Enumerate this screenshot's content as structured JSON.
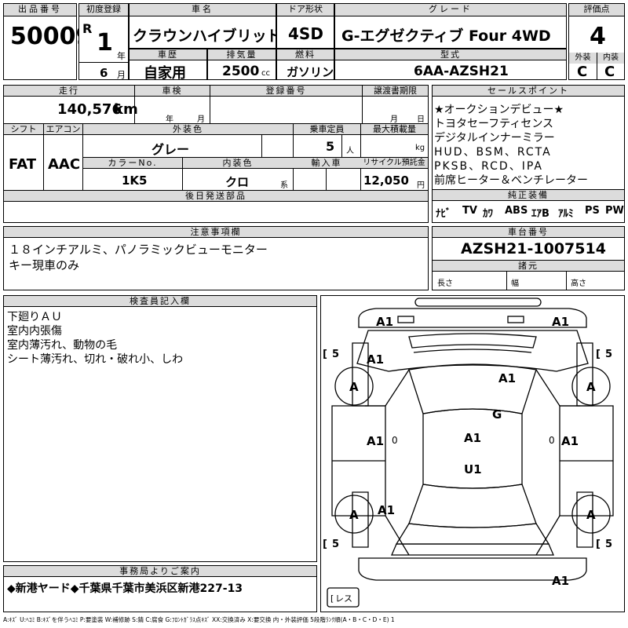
{
  "header": {
    "lot_label": "出品番号",
    "lot": "50009",
    "first_reg_label": "初度登録",
    "era": "R",
    "year": "1",
    "year_unit": "年",
    "month": "6",
    "month_unit": "月",
    "name_label": "車名",
    "name": "クラウンハイブリッド",
    "doors_label": "ドア形状",
    "doors": "4SD",
    "grade_label": "グレード",
    "grade": "G-エグゼクティブ Four 4WD",
    "score_label": "評価点",
    "score": "4",
    "ext_label": "外装",
    "ext": "C",
    "int_label": "内装",
    "int": "C",
    "history_label": "車歴",
    "history": "自家用",
    "disp_label": "排気量",
    "disp": "2500",
    "disp_unit": "cc",
    "fuel_label": "燃料",
    "fuel": "ガソリン",
    "model_label": "型式",
    "model": "6AA-AZSH21"
  },
  "specs": {
    "mileage_label": "走行",
    "mileage": "140,576",
    "mileage_unit": "km",
    "inspection_label": "車検",
    "insp_year": "年",
    "insp_month": "月",
    "reg_label": "登録番号",
    "transfer_label": "譲渡書期限",
    "transfer_month": "月",
    "transfer_day": "日",
    "shift_label": "シフト",
    "shift": "FAT",
    "ac_label": "エアコン",
    "ac": "AAC",
    "color_label": "外装色",
    "color": "グレー",
    "capacity_label": "乗車定員",
    "capacity": "5",
    "capacity_unit": "人",
    "load_label": "最大積載量",
    "load_unit": "kg",
    "colorno_label": "カラーNo.",
    "colorno": "1K5",
    "intcolor_label": "内装色",
    "intcolor": "クロ",
    "intcolor_unit": "系",
    "import_label": "輸入車",
    "recycle_label": "リサイクル預託金",
    "recycle": "12,050",
    "recycle_unit": "円",
    "later_label": "後日発送部品"
  },
  "sales": {
    "label": "セールスポイント",
    "lines": [
      "★オークションデビュー★",
      "トヨタセーフティセンス",
      "デジタルインナーミラー",
      "HUD、BSM、RCTA",
      "PKSB、RCD、IPA",
      "前席ヒーター＆ベンチレーター"
    ]
  },
  "equipment": {
    "label": "純正装備",
    "items": [
      "ﾅﾋﾞ",
      "TV",
      "ｶﾜ",
      "ABS",
      "ｴｱB",
      "ｱﾙﾐ",
      "PS",
      "PW"
    ]
  },
  "notes": {
    "label": "注意事項欄",
    "lines": [
      "１８インチアルミ、パノラミックビューモニター",
      "キー現車のみ"
    ]
  },
  "chassis": {
    "label": "車台番号",
    "value": "AZSH21-1007514",
    "dims_label": "諸元",
    "length": "長さ",
    "width": "幅",
    "height": "高さ"
  },
  "inspector": {
    "label": "検査員記入欄",
    "lines": [
      "下廻りＡＵ",
      "室内内張傷",
      "室内薄汚れ、動物の毛",
      "シート薄汚れ、切れ・破れ小、しわ"
    ]
  },
  "office": {
    "label": "事務局よりご案内",
    "text": "◆新港ヤード◆千葉県千葉市美浜区新港227-13"
  },
  "diagram": {
    "marks": {
      "front_bumper_left": "A1",
      "front_bumper_right": "A1",
      "hood_left": "A1",
      "windshield": "A1",
      "tire_fl": "A",
      "tire_fr": "A",
      "tire_rl": "A",
      "tire_rr": "A",
      "roof": "G",
      "door_fl": "A1",
      "door_fr": "A1",
      "interior": "A1",
      "floor": "U1",
      "door_rl": "A1",
      "rear_bumper": "A1",
      "small_0_left": "0",
      "small_0_right": "0",
      "tire_depth_fl": "5",
      "tire_depth_fr": "5",
      "tire_depth_rl": "5",
      "tire_depth_rr": "5",
      "spare": "レス"
    }
  },
  "legend": "A:ｷｽﾞ U:ﾍｺﾐ B:ｷｽﾞを伴うﾍｺﾐ P:要塗装 W:補修跡 S:錆 C:腐食 G:ﾌﾛﾝﾄｶﾞﾗｽ点ｷｽﾞ XX:交換済み X:要交換 内・外装評価 5段階ﾗﾝｸ順(A・B・C・D・E) 1"
}
